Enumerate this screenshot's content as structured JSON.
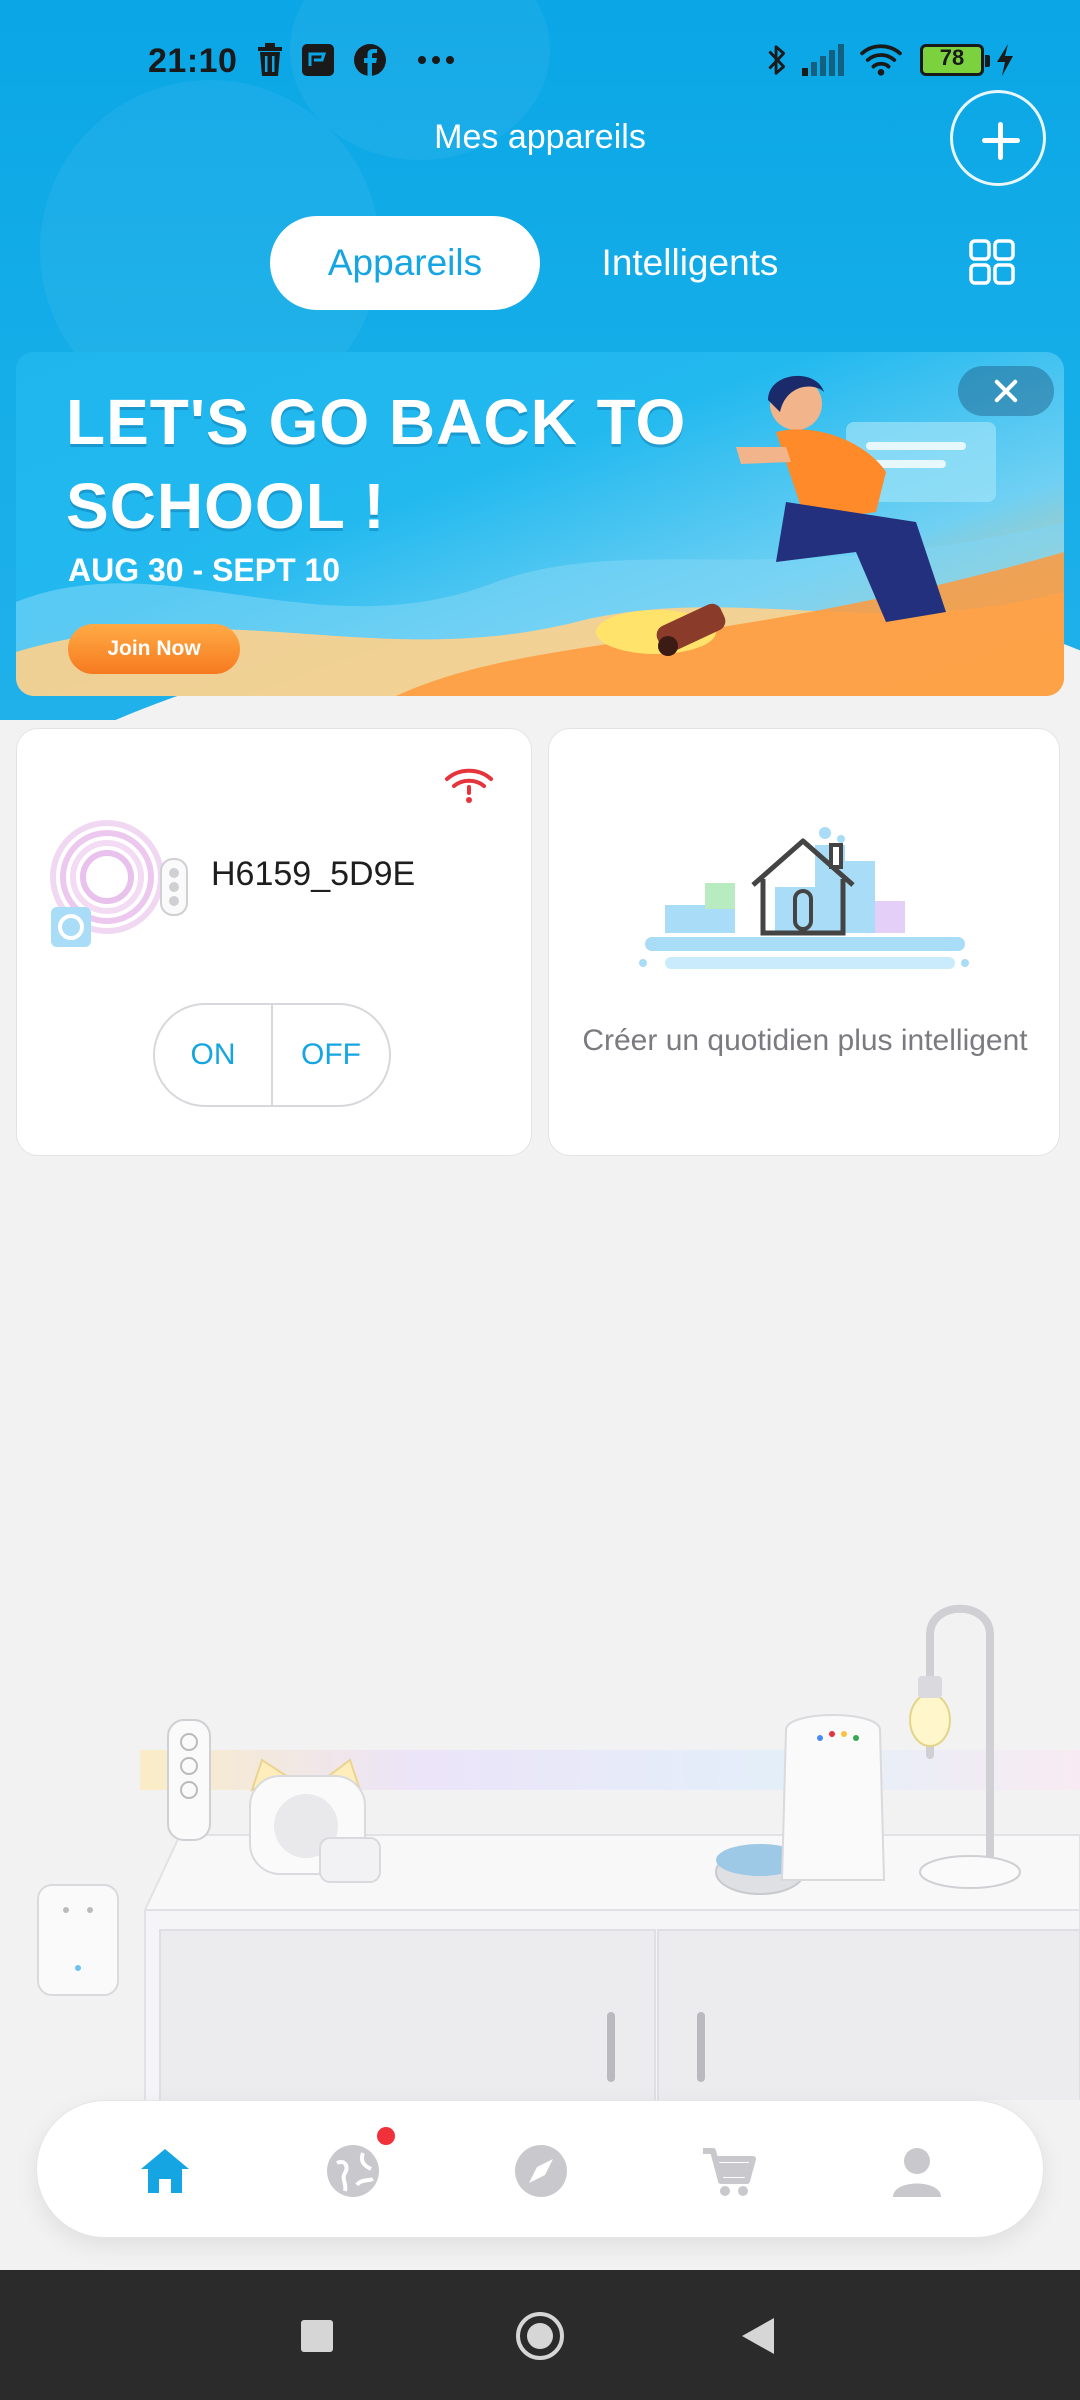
{
  "status_bar": {
    "time": "21:10",
    "battery": "78",
    "icons": [
      "trash-icon",
      "app-icon",
      "facebook-icon",
      "more-icon",
      "bluetooth-icon",
      "signal-icon",
      "wifi-icon",
      "battery-icon",
      "charging-icon"
    ]
  },
  "header": {
    "title": "Mes appareils",
    "add_icon": "plus-icon"
  },
  "tabs": [
    {
      "label": "Appareils",
      "active": true
    },
    {
      "label": "Intelligents",
      "active": false
    }
  ],
  "layout_toggle_icon": "grid-icon",
  "banner": {
    "headline_line1": "LET'S GO BACK TO",
    "headline_line2": "SCHOOL !",
    "dates": "AUG 30 - SEPT 10",
    "cta": "Join Now",
    "close_icon": "close-icon"
  },
  "devices": [
    {
      "name": "H6159_5D9E",
      "status_icon": "wifi-disconnected-icon",
      "on_label": "ON",
      "off_label": "OFF"
    }
  ],
  "smart_card": {
    "text": "Créer un quotidien plus intelligent"
  },
  "bottom_nav": [
    {
      "name": "home",
      "icon": "home-icon",
      "active": true
    },
    {
      "name": "community",
      "icon": "globe-icon",
      "notification": true
    },
    {
      "name": "discover",
      "icon": "compass-icon"
    },
    {
      "name": "shop",
      "icon": "cart-icon"
    },
    {
      "name": "profile",
      "icon": "user-icon"
    }
  ],
  "colors": {
    "accent": "#15a5e2",
    "header_blue": "#0aa6e6",
    "warning_red": "#e5343b",
    "background": "#f2f2f3"
  }
}
